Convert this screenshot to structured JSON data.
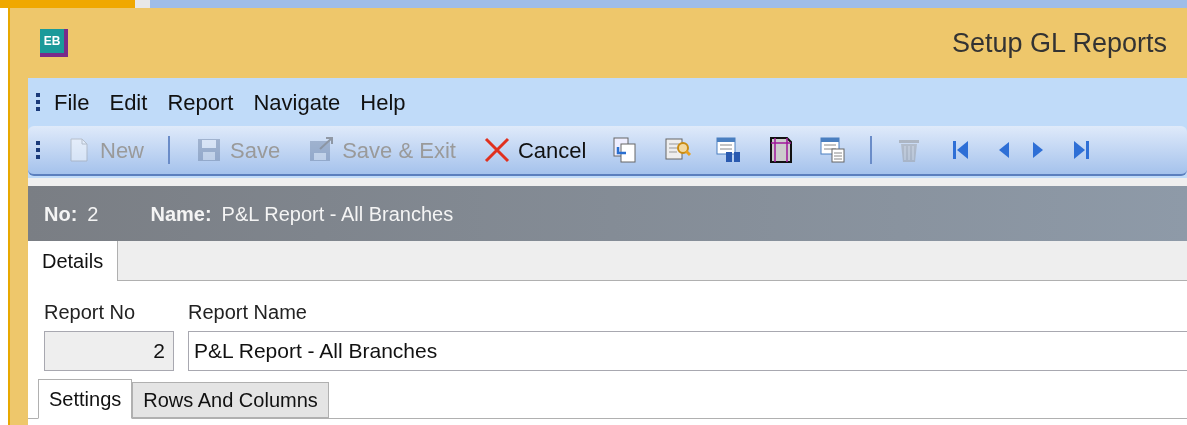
{
  "window": {
    "title": "Setup GL Reports",
    "app_icon": "EB"
  },
  "menu": [
    "File",
    "Edit",
    "Report",
    "Navigate",
    "Help"
  ],
  "toolbar": [
    {
      "kind": "button",
      "label": "New",
      "disabled": true
    },
    {
      "kind": "separator"
    },
    {
      "kind": "button",
      "label": "Save",
      "disabled": true
    },
    {
      "kind": "button",
      "label": "Save & Exit",
      "disabled": true
    },
    {
      "kind": "button",
      "label": "Cancel",
      "disabled": false
    },
    {
      "kind": "icon",
      "disabled": false
    },
    {
      "kind": "icon",
      "disabled": false
    },
    {
      "kind": "icon",
      "disabled": false
    },
    {
      "kind": "icon",
      "disabled": false
    },
    {
      "kind": "icon",
      "disabled": false
    },
    {
      "kind": "separator"
    },
    {
      "kind": "icon",
      "disabled": true
    },
    {
      "kind": "icon",
      "disabled": false
    },
    {
      "kind": "icon",
      "disabled": false
    },
    {
      "kind": "icon",
      "disabled": false
    },
    {
      "kind": "icon",
      "disabled": false
    }
  ],
  "header": {
    "no_label": "No:",
    "no_value": "2",
    "name_label": "Name:",
    "name_value": "P&L Report - All Branches"
  },
  "tabs": [
    {
      "label": "Details",
      "selected": true
    }
  ],
  "form": {
    "report_no": {
      "label": "Report No",
      "value": "2",
      "disabled": true
    },
    "report_name": {
      "label": "Report Name",
      "value": "P&L Report - All Branches"
    }
  },
  "sub_tabs": [
    {
      "label": "Settings",
      "selected": true
    },
    {
      "label": "Rows And Columns",
      "selected": false
    }
  ]
}
